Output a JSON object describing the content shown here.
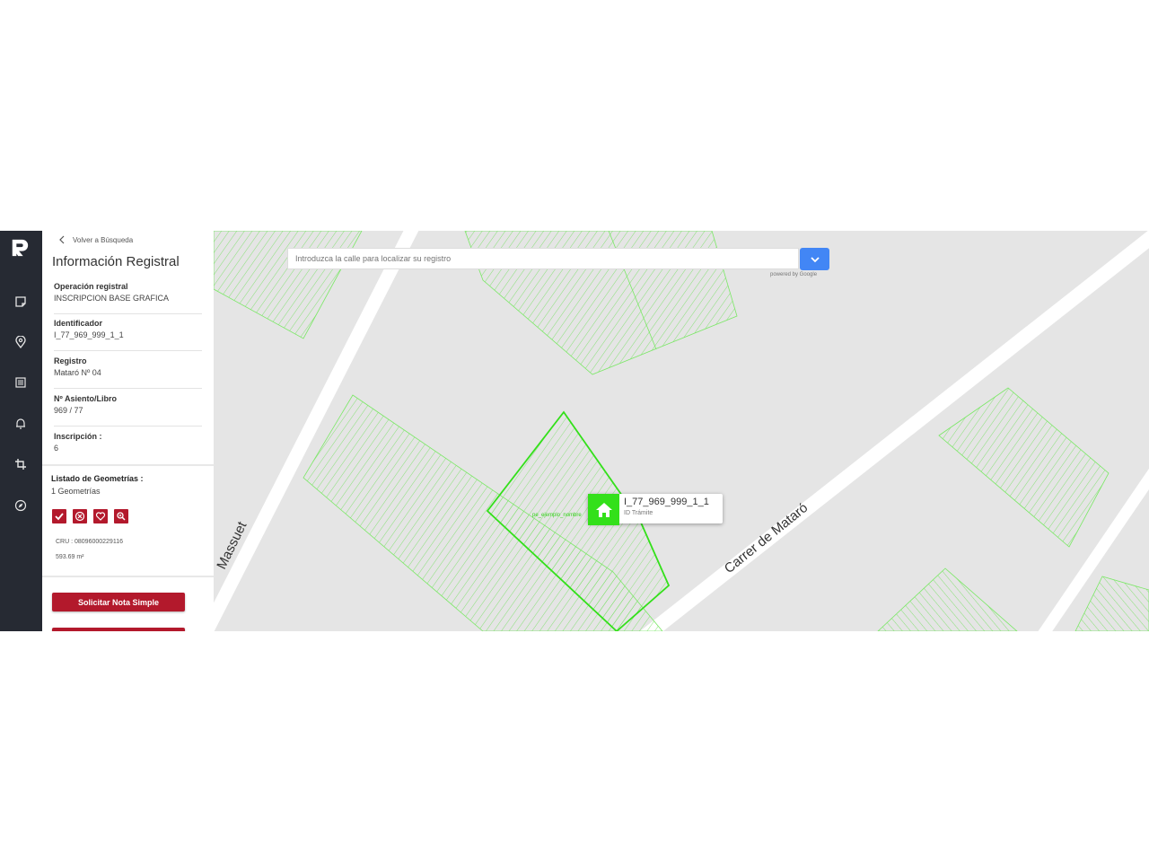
{
  "sidebar": {
    "back_label": "Volver a Búsqueda",
    "title": "Información Registral",
    "fields": [
      {
        "label": "Operación registral",
        "value": "INSCRIPCION BASE GRAFICA"
      },
      {
        "label": "Identificador",
        "value": "I_77_969_999_1_1"
      },
      {
        "label": "Registro",
        "value": "Mataró Nº 04"
      },
      {
        "label": "Nº Asiento/Libro",
        "value": "969 / 77"
      },
      {
        "label": "Inscripción :",
        "value": "6"
      }
    ],
    "geometries": {
      "title": "Listado de Geometrías :",
      "count": "1 Geometrías",
      "actions": [
        "check-icon",
        "cancel-circle-icon",
        "heart-icon",
        "zoom-icon"
      ],
      "cru": "CRU : 08096000229116",
      "area": "593.69 m²"
    },
    "request_button": "Solicitar Nota Simple"
  },
  "rail": {
    "icons": [
      "app-logo-icon",
      "note-icon",
      "location-pin-icon",
      "list-icon",
      "bell-icon",
      "crop-icon",
      "compass-icon"
    ]
  },
  "map": {
    "search_placeholder": "Introduzca la calle para localizar su registro",
    "powered_by": "powered by Google",
    "street_left": "Massuet",
    "street_right": "Carrer de Mataró",
    "popup": {
      "id": "I_77_969_999_1_1",
      "subtitle": "ID Trámite"
    },
    "small_label": "pe_ejemplo_nombre",
    "colors": {
      "parcel": "#33e01a",
      "road": "#ffffff",
      "background": "#e5e5e5"
    }
  },
  "colors": {
    "accent": "#b3192c",
    "rail": "#262a33",
    "search_button": "#4286f5"
  }
}
